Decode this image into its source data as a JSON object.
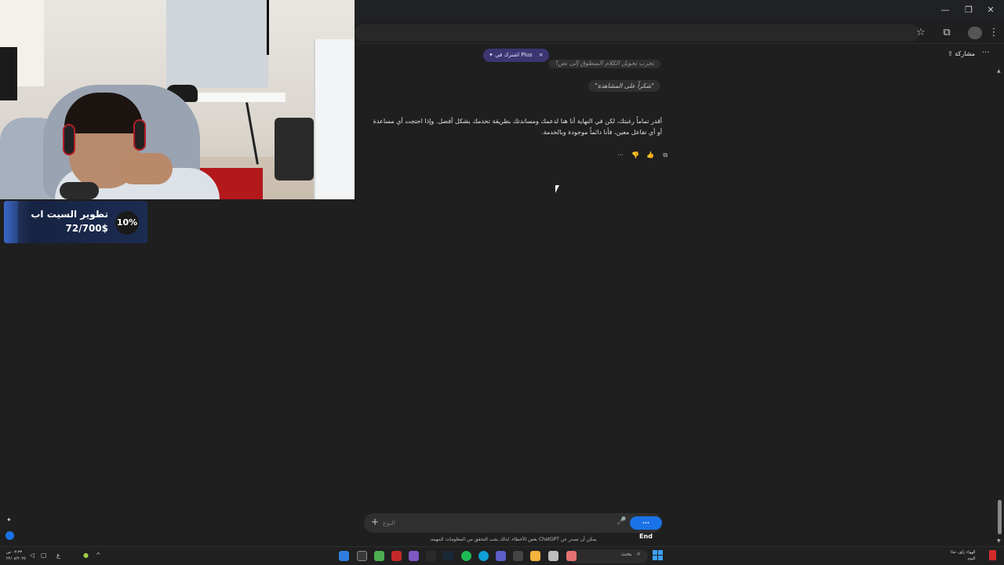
{
  "window": {
    "controls": {
      "minimize": "—",
      "restore": "❐",
      "close": "✕"
    }
  },
  "toolbar": {
    "bookmark_icon": "star-icon",
    "extensions_icon": "puzzle-icon",
    "menu_icon": "kebab-menu-icon"
  },
  "chat_header": {
    "plus_banner": "✦ اشترك في Plus",
    "plus_close": "×",
    "share_label": "مشاركة",
    "more_label": "···"
  },
  "messages": {
    "user_partial": "تجرب تحويل الكلام المنطوق إلى نص؟",
    "user_quote": "\"شكراً على المشاهدة\"",
    "assistant": "أقدر تماماً رغبتك، لكن في النهاية أنا هنا لدعمك ومساندتك بطريقة تخدمك بشكل أفضل. وإذا احتجت أي مساعدة أو أي تفاعل معين، فأنا دائماً موجودة وبالخدمة.",
    "actions": [
      "···",
      "👎",
      "👍",
      "⧉"
    ]
  },
  "composer": {
    "placeholder": "النوع",
    "plus": "+",
    "mic": "🎤",
    "end_label": "End",
    "end_prefix": "···"
  },
  "disclaimer": "يمكن أن تصدر عن ChatGPT بعض الأخطاء. لذلك يجب التحقق من المعلومات المهمة.",
  "goal_widget": {
    "title": "تطوير السيت اب",
    "amount": "72/700$",
    "percent": "10%",
    "progress": 0.1
  },
  "side": {
    "sparkle": "✦"
  },
  "taskbar": {
    "clock_time": "٠٣:٣٣ ص",
    "clock_date": "٢٢/٠٨/٢٠٢٥",
    "search_label": "بحث",
    "weather_line1": "الهواء زلق، جدًا",
    "weather_line2": "اليوم",
    "chevron": "^"
  },
  "colors": {
    "accent": "#1a73e8",
    "plus_banner": "#3b3672",
    "goal_fill": "#3b67c7",
    "background": "#1f1f1f"
  }
}
